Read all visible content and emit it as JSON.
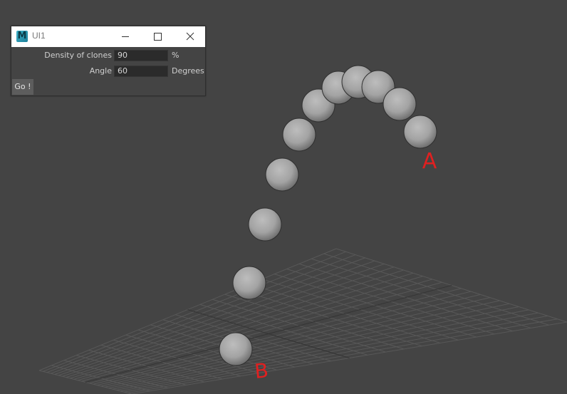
{
  "window": {
    "title": "UI1",
    "app_icon_letter": "M"
  },
  "fields": [
    {
      "label": "Density of clones",
      "value": "90",
      "unit": "%"
    },
    {
      "label": "Angle",
      "value": "60",
      "unit": "Degrees"
    }
  ],
  "go_button": "Go !",
  "annotations": {
    "a": "A",
    "b": "B"
  },
  "colors": {
    "viewport_bg": "#444444",
    "annotation": "#e02020",
    "sphere": "#a0a0a0",
    "grid": "#5a5a5a"
  }
}
